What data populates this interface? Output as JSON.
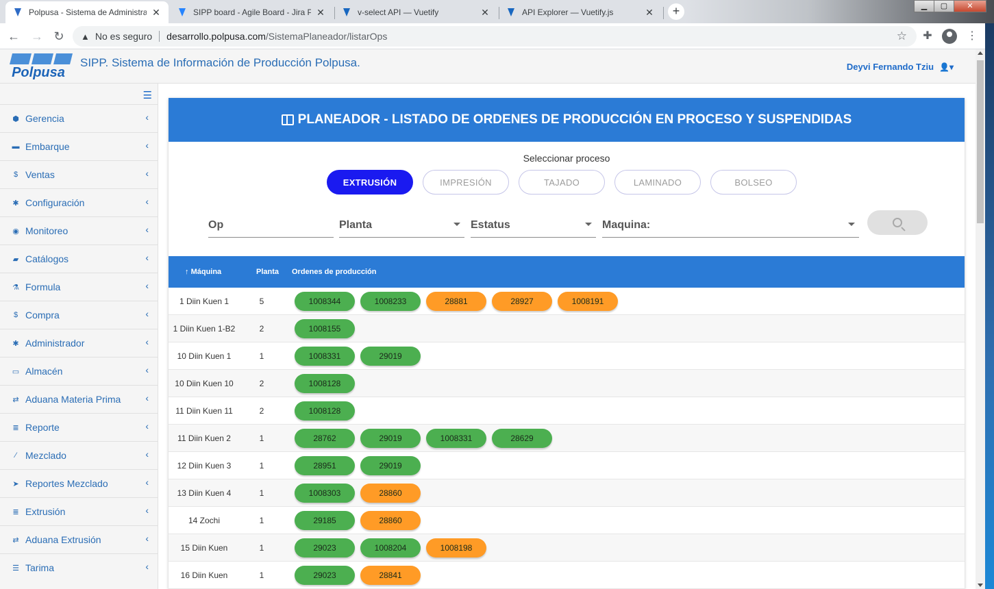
{
  "browser": {
    "tabs": [
      {
        "title": "Polpusa - Sistema de Administrac",
        "active": true
      },
      {
        "title": "SIPP board - Agile Board - Jira Pc",
        "active": false
      },
      {
        "title": "v-select API — Vuetify",
        "active": false
      },
      {
        "title": "API Explorer — Vuetify.js",
        "active": false
      }
    ],
    "close_glyph": "✕",
    "newtab_glyph": "+",
    "not_secure": "No es seguro",
    "url_host": "desarrollo.polpusa.com",
    "url_path": "/SistemaPlaneador/listarOps"
  },
  "header": {
    "logo_text": "Polpusa",
    "title": "SIPP. Sistema de Información de Producción Polpusa.",
    "user": "Deyvi Fernando Tziu"
  },
  "sidebar": {
    "items": [
      {
        "label": "Gerencia",
        "icon": "cube-icon",
        "glyph": "⬢"
      },
      {
        "label": "Embarque",
        "icon": "truck-icon",
        "glyph": "▬"
      },
      {
        "label": "Ventas",
        "icon": "dollar-icon",
        "glyph": "$"
      },
      {
        "label": "Configuración",
        "icon": "gear-icon",
        "glyph": "✱"
      },
      {
        "label": "Monitoreo",
        "icon": "eye-icon",
        "glyph": "◉"
      },
      {
        "label": "Catálogos",
        "icon": "folder-icon",
        "glyph": "▰"
      },
      {
        "label": "Formula",
        "icon": "flask-icon",
        "glyph": "⚗"
      },
      {
        "label": "Compra",
        "icon": "dollar-icon",
        "glyph": "$"
      },
      {
        "label": "Administrador",
        "icon": "gear-icon",
        "glyph": "✱"
      },
      {
        "label": "Almacén",
        "icon": "laptop-icon",
        "glyph": "▭"
      },
      {
        "label": "Aduana Materia Prima",
        "icon": "exchange-icon",
        "glyph": "⇄"
      },
      {
        "label": "Reporte",
        "icon": "database-icon",
        "glyph": "≣"
      },
      {
        "label": "Mezclado",
        "icon": "magic-icon",
        "glyph": "⁄"
      },
      {
        "label": "Reportes Mezclado",
        "icon": "send-icon",
        "glyph": "➤"
      },
      {
        "label": "Extrusión",
        "icon": "database-icon",
        "glyph": "≣"
      },
      {
        "label": "Aduana Extrusión",
        "icon": "exchange-icon",
        "glyph": "⇄"
      },
      {
        "label": "Tarima",
        "icon": "bars-icon",
        "glyph": "☰"
      }
    ],
    "chevron": "‹"
  },
  "main": {
    "card_title": "PLANEADOR - LISTADO DE ORDENES DE PRODUCCIÓN EN PROCESO Y SUSPENDIDAS",
    "process_label": "Seleccionar proceso",
    "processes": [
      {
        "label": "EXTRUSIÓN",
        "active": true
      },
      {
        "label": "IMPRESIÓN",
        "active": false
      },
      {
        "label": "TAJADO",
        "active": false
      },
      {
        "label": "LAMINADO",
        "active": false
      },
      {
        "label": "BOLSEO",
        "active": false
      }
    ],
    "filters": {
      "op": "Op",
      "planta": "Planta",
      "estatus": "Estatus",
      "maquina": "Maquina:"
    },
    "table": {
      "headers": {
        "maquina": "Máquina",
        "planta": "Planta",
        "ordenes": "Ordenes de producción"
      },
      "sort_glyph": "↑",
      "rows": [
        {
          "maquina": "1 Diin Kuen 1",
          "planta": "5",
          "orders": [
            {
              "n": "1008344",
              "c": "green"
            },
            {
              "n": "1008233",
              "c": "green"
            },
            {
              "n": "28881",
              "c": "orange"
            },
            {
              "n": "28927",
              "c": "orange"
            },
            {
              "n": "1008191",
              "c": "orange"
            }
          ]
        },
        {
          "maquina": "1 Diin Kuen 1-B2",
          "planta": "2",
          "orders": [
            {
              "n": "1008155",
              "c": "green"
            }
          ]
        },
        {
          "maquina": "10 Diin Kuen 1",
          "planta": "1",
          "orders": [
            {
              "n": "1008331",
              "c": "green"
            },
            {
              "n": "29019",
              "c": "green"
            }
          ]
        },
        {
          "maquina": "10 Diin Kuen 10",
          "planta": "2",
          "orders": [
            {
              "n": "1008128",
              "c": "green"
            }
          ]
        },
        {
          "maquina": "11 Diin Kuen 11",
          "planta": "2",
          "orders": [
            {
              "n": "1008128",
              "c": "green"
            }
          ]
        },
        {
          "maquina": "11 Diin Kuen 2",
          "planta": "1",
          "orders": [
            {
              "n": "28762",
              "c": "green"
            },
            {
              "n": "29019",
              "c": "green"
            },
            {
              "n": "1008331",
              "c": "green"
            },
            {
              "n": "28629",
              "c": "green"
            }
          ]
        },
        {
          "maquina": "12 Diin Kuen 3",
          "planta": "1",
          "orders": [
            {
              "n": "28951",
              "c": "green"
            },
            {
              "n": "29019",
              "c": "green"
            }
          ]
        },
        {
          "maquina": "13 Diin Kuen 4",
          "planta": "1",
          "orders": [
            {
              "n": "1008303",
              "c": "green"
            },
            {
              "n": "28860",
              "c": "orange"
            }
          ]
        },
        {
          "maquina": "14 Zochi",
          "planta": "1",
          "orders": [
            {
              "n": "29185",
              "c": "green"
            },
            {
              "n": "28860",
              "c": "orange"
            }
          ]
        },
        {
          "maquina": "15 Diin Kuen",
          "planta": "1",
          "orders": [
            {
              "n": "29023",
              "c": "green"
            },
            {
              "n": "1008204",
              "c": "green"
            },
            {
              "n": "1008198",
              "c": "orange"
            }
          ]
        },
        {
          "maquina": "16 Diin Kuen",
          "planta": "1",
          "orders": [
            {
              "n": "29023",
              "c": "green"
            },
            {
              "n": "28841",
              "c": "orange"
            }
          ]
        }
      ]
    }
  },
  "colors": {
    "primary": "#2b7bd6",
    "active_process": "#1a1af0",
    "chip_green": "#4caf50",
    "chip_orange": "#ff9b26"
  }
}
